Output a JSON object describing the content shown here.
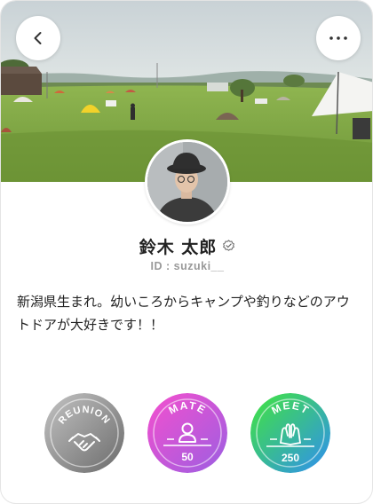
{
  "header": {
    "back_icon": "chevron-left-icon",
    "more_icon": "ellipsis-icon"
  },
  "profile": {
    "name": "鈴木 太郎",
    "verified_icon": "verified-badge-icon",
    "id_text": "ID : suzuki__",
    "bio": "新潟県生まれ。幼いころからキャンプや釣りなどのアウトドアが大好きです！！"
  },
  "badges": [
    {
      "label": "REUNION",
      "count": "",
      "icon": "handshake-icon",
      "colors": [
        "#b9b9b9",
        "#6f6f6f"
      ]
    },
    {
      "label": "MATE",
      "count": "50",
      "icon": "person-icon",
      "colors": [
        "#f04fd1",
        "#a05fe0"
      ]
    },
    {
      "label": "MEET",
      "count": "250",
      "icon": "high-five-icon",
      "colors": [
        "#3be24a",
        "#2f8ff0"
      ]
    }
  ],
  "colors": {
    "text_primary": "#222222",
    "text_muted": "#999999",
    "card_border": "#e4e4e4"
  }
}
